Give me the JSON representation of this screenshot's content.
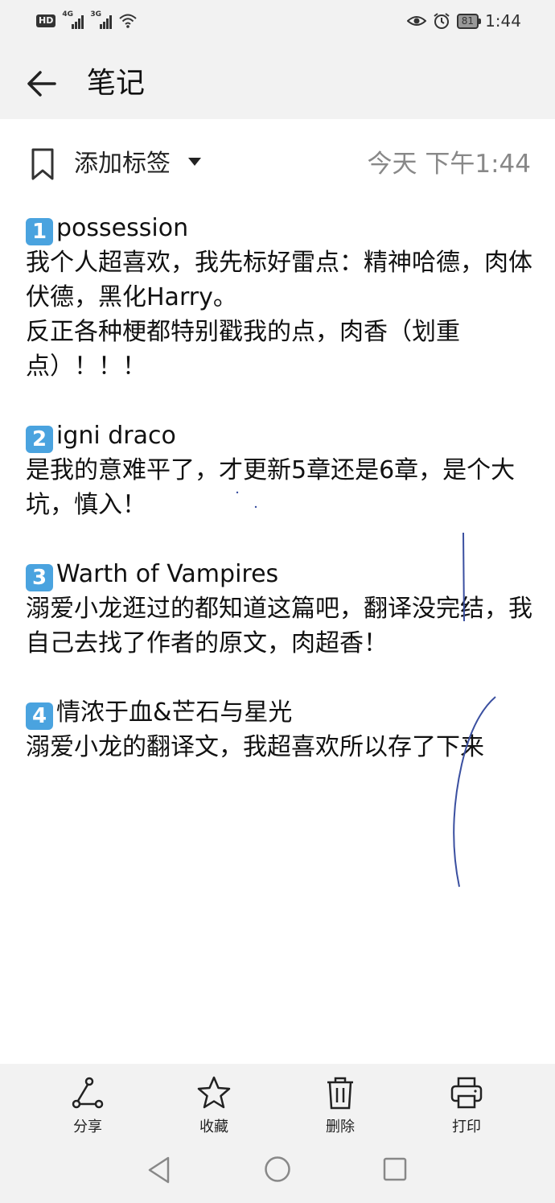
{
  "status_bar": {
    "hd_badge": "HD",
    "network_1": "4G",
    "network_2": "3G",
    "icons": [
      "wifi-icon",
      "eye-icon",
      "alarm-icon"
    ],
    "battery": "81",
    "time": "1:44"
  },
  "app_bar": {
    "title": "笔记",
    "back_icon": "arrow-left-icon"
  },
  "meta": {
    "tag_label": "添加标签",
    "timestamp": "今天 下午1:44"
  },
  "note": {
    "sections": [
      {
        "number": "1",
        "title": "possession",
        "lines": [
          "我个人超喜欢，我先标好雷点：精神哈德，肉体伏德，黑化Harry。",
          "反正各种梗都特别戳我的点，肉香（划重点）！！！"
        ]
      },
      {
        "number": "2",
        "title": "igni draco",
        "lines": [
          "是我的意难平了，才更新5章还是6章，是个大坑，慎入！"
        ]
      },
      {
        "number": "3",
        "title": "Warth of Vampires",
        "lines": [
          "溺爱小龙逛过的都知道这篇吧，翻译没完结，我自己去找了作者的原文，肉超香！"
        ]
      },
      {
        "number": "4",
        "title": "情浓于血&芒石与星光",
        "lines": [
          "溺爱小龙的翻译文，我超喜欢所以存了下来"
        ]
      }
    ]
  },
  "actions": [
    {
      "label": "分享",
      "icon": "share-icon"
    },
    {
      "label": "收藏",
      "icon": "star-icon"
    },
    {
      "label": "删除",
      "icon": "trash-icon"
    },
    {
      "label": "打印",
      "icon": "printer-icon"
    }
  ],
  "colors": {
    "bar_background": "#f2f2f2",
    "number_badge": "#4aa3df",
    "pen_stroke": "#3a4fa0",
    "timestamp": "#888888"
  }
}
